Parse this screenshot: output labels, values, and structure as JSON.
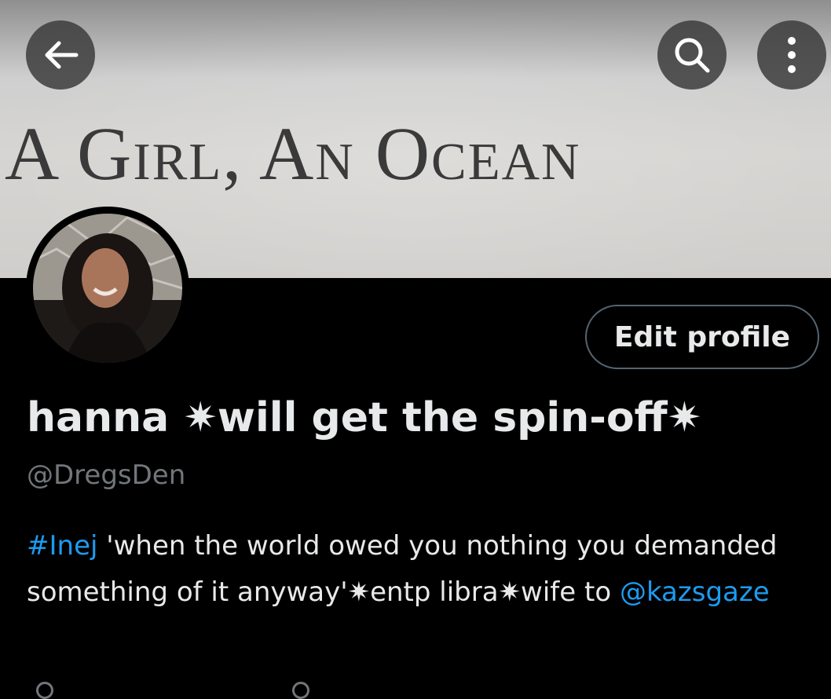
{
  "banner": {
    "text": "A Girl, An Ocean"
  },
  "top_bar": {
    "back_icon": "arrow-left-icon",
    "search_icon": "search-icon",
    "more_icon": "more-vertical-icon"
  },
  "profile": {
    "edit_button_label": "Edit profile",
    "display_name": "hanna ✷will get the spin-off✷",
    "handle": "@DregsDen",
    "bio": {
      "hashtag": "#Inej",
      "text_1": " 'when the world owed you nothing you demanded something of it anyway'✷entp libra✷wife to ",
      "mention": "@kazsgaze"
    }
  },
  "colors": {
    "background": "#000000",
    "text_primary": "#e7e9ea",
    "text_secondary": "#71767b",
    "link": "#1d9bf0",
    "button_border": "#536471"
  }
}
